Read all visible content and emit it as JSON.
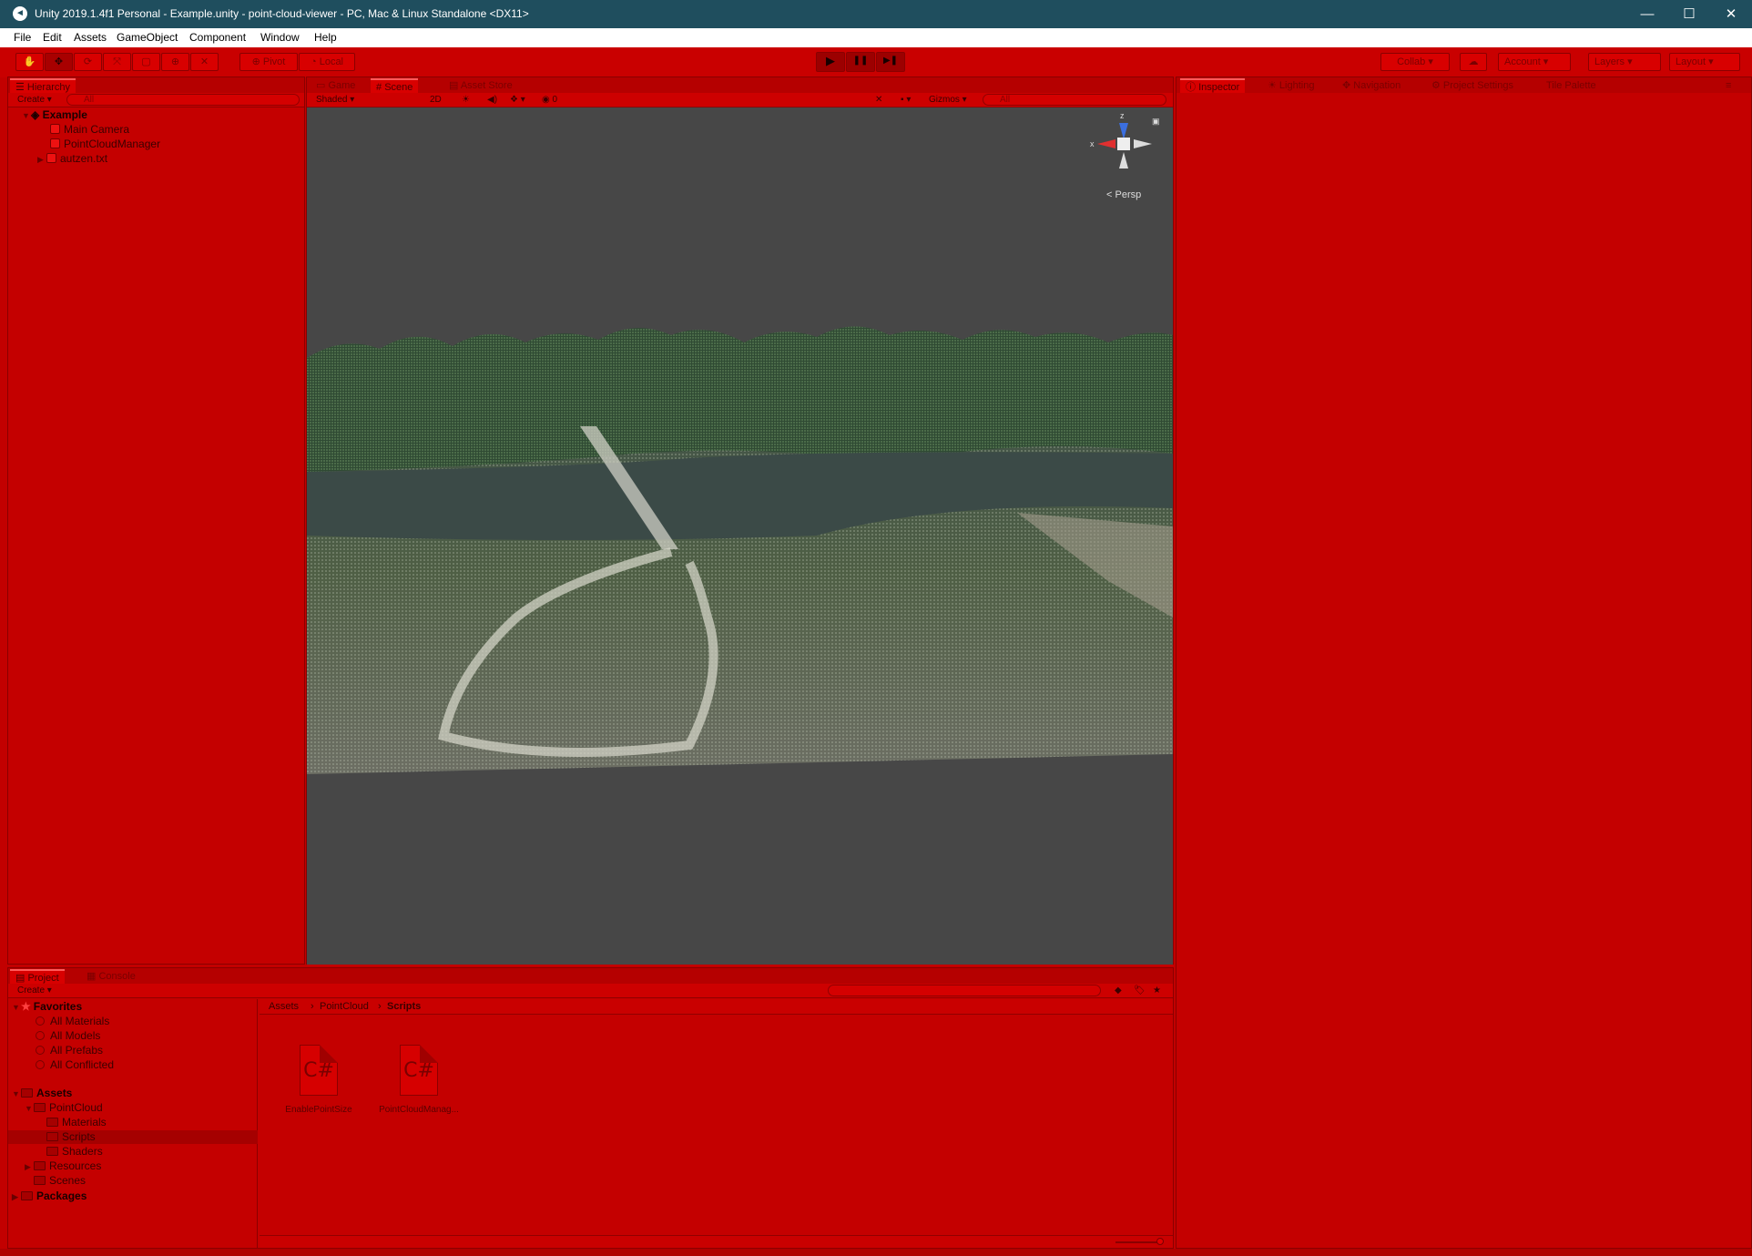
{
  "window": {
    "title": "Unity 2019.1.4f1 Personal - Example.unity - point-cloud-viewer - PC, Mac & Linux Standalone <DX11>",
    "minimize": "—",
    "maximize": "☐",
    "close": "✕"
  },
  "menu": [
    "File",
    "Edit",
    "Assets",
    "GameObject",
    "Component",
    "Window",
    "Help"
  ],
  "toolbar": {
    "pivot": "Pivot",
    "local": "Local",
    "play": "▶",
    "pause": "❚❚",
    "step": "▶❚",
    "collab": "Collab ▾",
    "account": "Account",
    "layers": "Layers",
    "layout": "Layout"
  },
  "hierarchy": {
    "tab": "Hierarchy",
    "create": "Create ▾",
    "search_placeholder": "All",
    "scene": "Example",
    "items": [
      "Main Camera",
      "PointCloudManager",
      "autzen.txt"
    ]
  },
  "scene_view": {
    "tabs": [
      "Game",
      "Scene",
      "Asset Store"
    ],
    "shading": "Shaded",
    "mode_2d": "2D",
    "fx_count": "0",
    "gizmos": "Gizmos ▾",
    "search_placeholder": "All",
    "persp": "Persp",
    "axis_z": "z",
    "axis_x": "x"
  },
  "inspector": {
    "tabs": [
      "Inspector",
      "Lighting",
      "Navigation",
      "Project Settings",
      "Tile Palette"
    ]
  },
  "project": {
    "tabs": [
      "Project",
      "Console"
    ],
    "create": "Create ▾",
    "favorites_label": "Favorites",
    "favorites": [
      "All Materials",
      "All Models",
      "All Prefabs",
      "All Conflicted"
    ],
    "assets_label": "Assets",
    "tree": {
      "pointcloud": "PointCloud",
      "materials": "Materials",
      "scripts": "Scripts",
      "shaders": "Shaders",
      "resources": "Resources",
      "scenes": "Scenes",
      "packages": "Packages"
    },
    "breadcrumb": [
      "Assets",
      "PointCloud",
      "Scripts"
    ],
    "files": [
      {
        "icon": "C#",
        "name": "EnablePointSize"
      },
      {
        "icon": "C#",
        "name": "PointCloudManag..."
      }
    ]
  }
}
